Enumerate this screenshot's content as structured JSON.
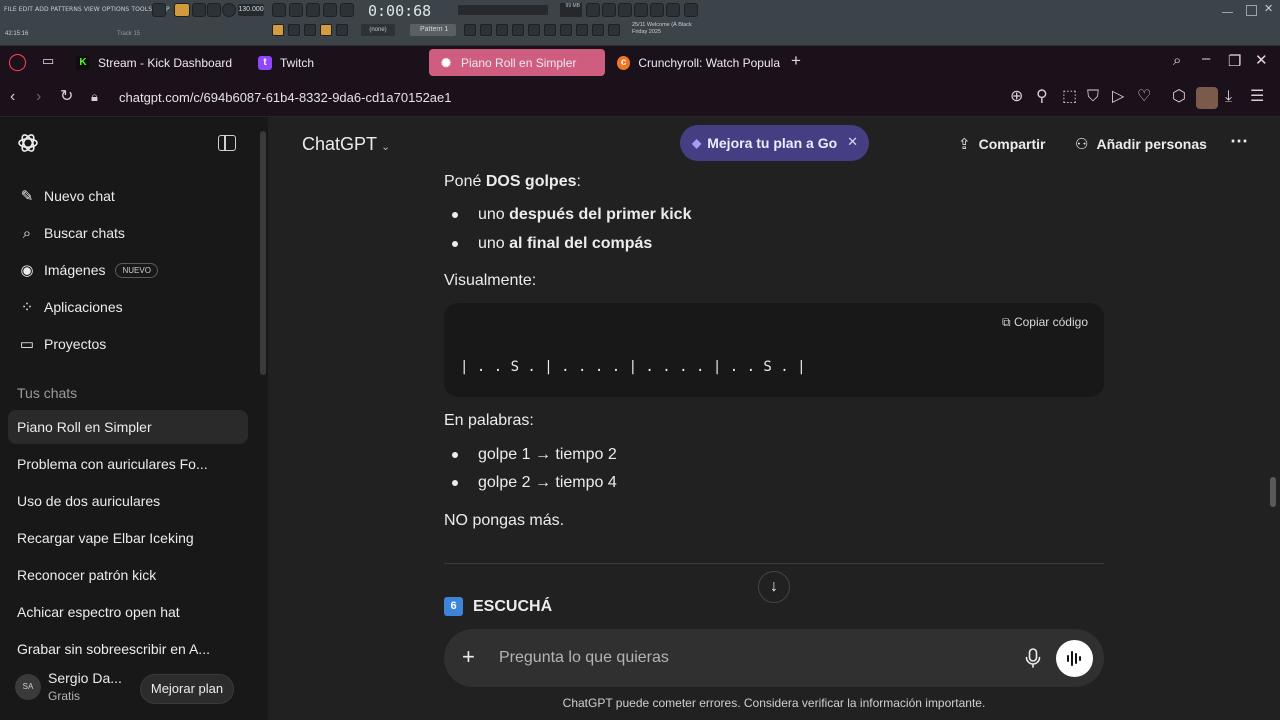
{
  "fl_studio": {
    "menu": "FILE EDIT ADD PATTERNS VIEW OPTIONS TOOLS HELP",
    "time": "42:15:16",
    "track": "Track 15",
    "tempo": "130.000",
    "clock": "0:00:68",
    "pattern": "Pattern 1",
    "none": "(none)",
    "cpu": "99 MB",
    "welcome_line1": "25/11  Welcome (À Black",
    "welcome_line2": "Friday 2025"
  },
  "browser": {
    "tabs": [
      {
        "label": "Stream - Kick Dashboard",
        "icon": "kick-icon",
        "color": "#53fc18"
      },
      {
        "label": "Twitch",
        "icon": "twitch-icon",
        "color": "#9146ff"
      },
      {
        "label": "Piano Roll en Simpler",
        "icon": "openai-icon",
        "active": true
      },
      {
        "label": "Crunchyroll: Watch Popula",
        "icon": "crunchyroll-icon",
        "color": "#f47521"
      }
    ],
    "url": "chatgpt.com/c/694b6087-61b4-8332-9da6-cd1a70152ae1"
  },
  "sidebar": {
    "nav": [
      {
        "label": "Nuevo chat",
        "icon": "edit-icon"
      },
      {
        "label": "Buscar chats",
        "icon": "search-icon"
      },
      {
        "label": "Imágenes",
        "icon": "image-icon",
        "badge": "NUEVO"
      },
      {
        "label": "Aplicaciones",
        "icon": "apps-icon"
      },
      {
        "label": "Proyectos",
        "icon": "folder-icon"
      }
    ],
    "section_title": "Tus chats",
    "chats": [
      "Piano Roll en Simpler",
      "Problema con auriculares Fo...",
      "Uso de dos auriculares",
      "Recargar vape Elbar Iceking",
      "Reconocer patrón kick",
      "Achicar espectro open hat",
      "Grabar sin sobreescribir en A..."
    ],
    "user": {
      "initials": "SA",
      "name": "Sergio Da...",
      "plan": "Gratis",
      "upgrade_label": "Mejorar plan"
    }
  },
  "header": {
    "model": "ChatGPT",
    "promo": "Mejora tu plan a Go",
    "share": "Compartir",
    "add_people": "Añadir personas"
  },
  "message": {
    "intro_plain": "Poné ",
    "intro_bold": "DOS golpes",
    "intro_end": ":",
    "bullets1": [
      {
        "plain": "uno ",
        "bold": "después del primer kick"
      },
      {
        "plain": "uno ",
        "bold": "al final del compás"
      }
    ],
    "visual_label": "Visualmente:",
    "copy_label": "Copiar código",
    "code": "| . . S . | . . . . | . . . . | . . S . |",
    "words_label": "En palabras:",
    "bullets2": [
      "golpe 1 → tiempo 2",
      "golpe 2 → tiempo 4"
    ],
    "closing": "NO pongas más.",
    "next_section_num": "6",
    "next_section": "ESCUCHÁ"
  },
  "composer": {
    "placeholder": "Pregunta lo que quieras"
  },
  "disclaimer": "ChatGPT puede cometer errores. Considera verificar la información importante."
}
